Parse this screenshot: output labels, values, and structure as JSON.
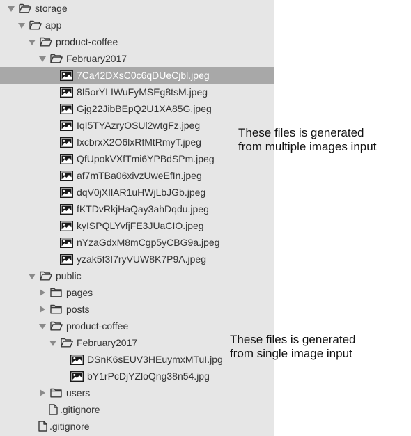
{
  "tree": [
    {
      "depth": 0,
      "kind": "folder-open",
      "label": "storage",
      "name": "folder-storage"
    },
    {
      "depth": 1,
      "kind": "folder-open",
      "label": "app",
      "name": "folder-app"
    },
    {
      "depth": 2,
      "kind": "folder-open",
      "label": "product-coffee",
      "name": "folder-product-coffee"
    },
    {
      "depth": 3,
      "kind": "folder-open",
      "label": "February2017",
      "name": "folder-february2017"
    },
    {
      "depth": 4,
      "kind": "image",
      "label": "7Ca42DXsC0c6qDUeCjbl.jpeg",
      "selected": true
    },
    {
      "depth": 4,
      "kind": "image",
      "label": "8I5orYLIWuFyMSEg8tsM.jpeg"
    },
    {
      "depth": 4,
      "kind": "image",
      "label": "Gjg22JibBEpQ2U1XA85G.jpeg"
    },
    {
      "depth": 4,
      "kind": "image",
      "label": "IqI5TYAzryOSUl2wtgFz.jpeg"
    },
    {
      "depth": 4,
      "kind": "image",
      "label": "IxcbrxX2O6lxRfMtRmyT.jpeg"
    },
    {
      "depth": 4,
      "kind": "image",
      "label": "QfUpokVXfTmi6YPBdSPm.jpeg"
    },
    {
      "depth": 4,
      "kind": "image",
      "label": "af7mTBa06xivzUweEfIn.jpeg"
    },
    {
      "depth": 4,
      "kind": "image",
      "label": "dqV0jXIlAR1uHWjLbJGb.jpeg"
    },
    {
      "depth": 4,
      "kind": "image",
      "label": "fKTDvRkjHaQay3ahDqdu.jpeg"
    },
    {
      "depth": 4,
      "kind": "image",
      "label": "kyISPQLYvfjFE3JUaCIO.jpeg"
    },
    {
      "depth": 4,
      "kind": "image",
      "label": "nYzaGdxM8mCgp5yCBG9a.jpeg"
    },
    {
      "depth": 4,
      "kind": "image",
      "label": "yzak5f3I7ryVUW8K7P9A.jpeg"
    },
    {
      "depth": 2,
      "kind": "folder-open",
      "label": "public",
      "name": "folder-public"
    },
    {
      "depth": 3,
      "kind": "folder-closed",
      "label": "pages",
      "name": "folder-pages"
    },
    {
      "depth": 3,
      "kind": "folder-closed",
      "label": "posts",
      "name": "folder-posts"
    },
    {
      "depth": 3,
      "kind": "folder-open",
      "label": "product-coffee",
      "name": "folder-public-product-coffee"
    },
    {
      "depth": 4,
      "kind": "folder-open",
      "label": "February2017",
      "name": "folder-public-february2017"
    },
    {
      "depth": 5,
      "kind": "image",
      "label": "DSnK6sEUV3HEuymxMTuI.jpg"
    },
    {
      "depth": 5,
      "kind": "image",
      "label": "bY1rPcDjYZloQng38n54.jpg"
    },
    {
      "depth": 3,
      "kind": "folder-closed",
      "label": "users",
      "name": "folder-users"
    },
    {
      "depth": 3,
      "kind": "file",
      "label": ".gitignore",
      "name": "file-public-gitignore"
    },
    {
      "depth": 2,
      "kind": "file",
      "label": ".gitignore",
      "name": "file-app-gitignore"
    }
  ],
  "annotations": {
    "multiple": {
      "line1": "These files is generated",
      "line2": "from multiple images input"
    },
    "single": {
      "line1": "These files is generated",
      "line2": "from single image input"
    }
  },
  "colors": {
    "panel_background": "#e6e6e6",
    "selected_row": "#a8a8a8",
    "text": "#333333",
    "icon": "#3a3a3a"
  }
}
